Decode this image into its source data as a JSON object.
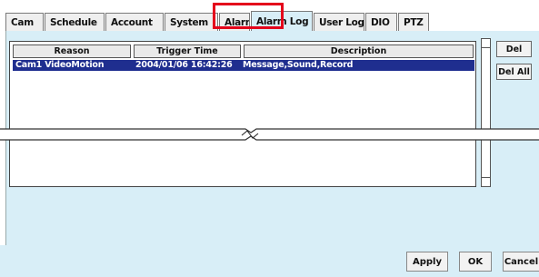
{
  "tabs": [
    "Cam",
    "Schedule",
    "Account",
    "System",
    "Alarm",
    "Alarm Log",
    "User Log",
    "DIO",
    "PTZ"
  ],
  "active_tab": "Alarm Log",
  "log_table": {
    "columns": [
      "Reason",
      "Trigger Time",
      "Description"
    ],
    "rows": [
      {
        "reason": "Cam1 VideoMotion",
        "trigger_time": "2004/01/06 16:42:26",
        "description": "Message,Sound,Record"
      }
    ]
  },
  "side_buttons": {
    "del": "Del",
    "del_all": "Del All"
  },
  "bottom_buttons": {
    "apply": "Apply",
    "ok": "OK",
    "cancel": "Cancel"
  }
}
